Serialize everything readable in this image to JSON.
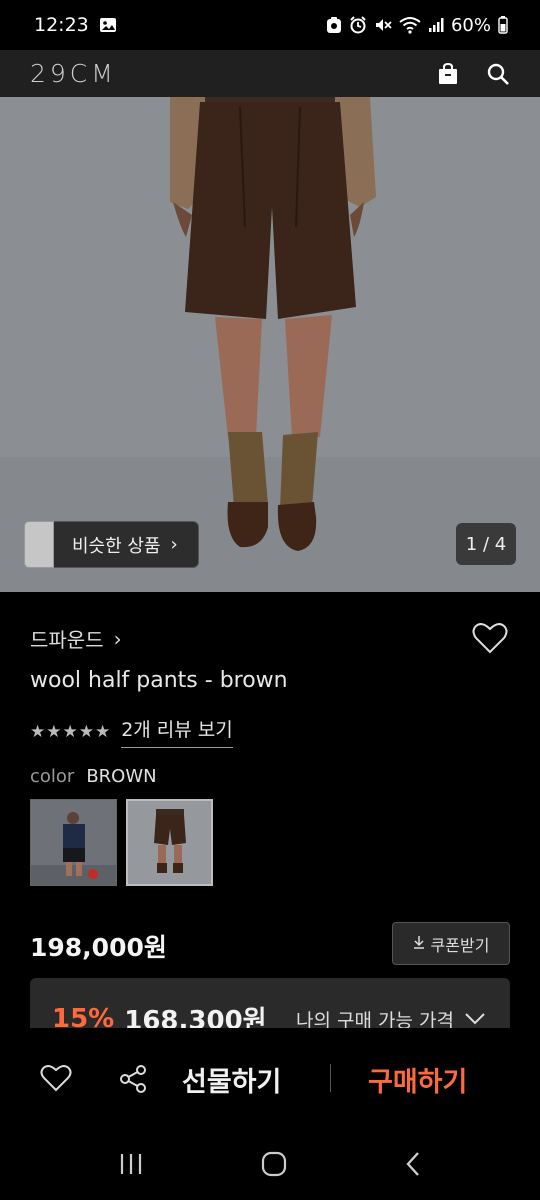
{
  "status_bar": {
    "time": "12:23",
    "battery": "60%"
  },
  "header": {
    "logo": "29CM",
    "icons": [
      "shopping-bag-icon",
      "search-icon"
    ]
  },
  "hero": {
    "similar_label": "비슷한 상품",
    "similar_chevron": "›",
    "page_indicator": "1 / 4"
  },
  "product": {
    "brand": "드파운드",
    "brand_chevron": "›",
    "name": "wool half pants - brown",
    "stars": "★★★★★",
    "rating": 5,
    "review_link": "2개 리뷰 보기",
    "color_label": "color",
    "color_value": "BROWN",
    "price": "198,000원",
    "coupon_label": "쿠폰받기",
    "discount_pct": "15%",
    "discount_price": "168,300원",
    "my_price_label": "나의 구매 가능 가격"
  },
  "bottom_bar": {
    "gift_label": "선물하기",
    "buy_label": "구매하기"
  },
  "colors": {
    "accent": "#ff6a3d",
    "header_bg": "#202020",
    "background": "#000000"
  }
}
